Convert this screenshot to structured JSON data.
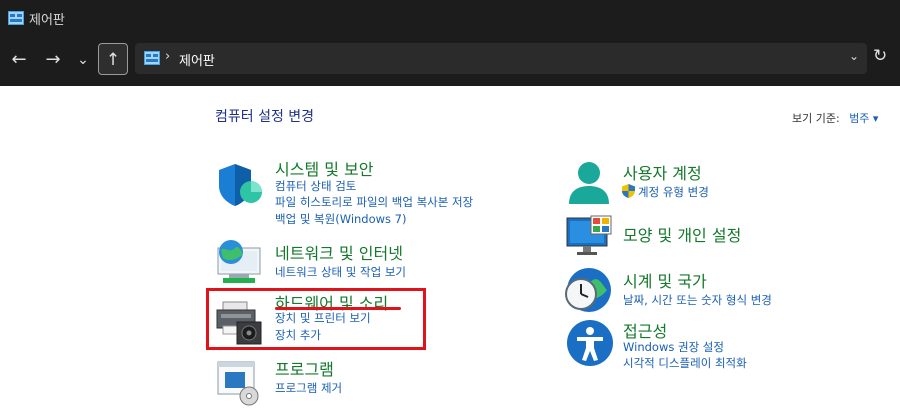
{
  "window": {
    "title": "제어판"
  },
  "nav": {
    "back": "←",
    "forward": "→",
    "recent": "⌄",
    "up": "↑",
    "refresh": "↻",
    "breadcrumb": "제어판",
    "separator": "›",
    "dropdown": "⌄"
  },
  "main": {
    "heading": "컴퓨터 설정 변경",
    "view_by_label": "보기 기준:",
    "view_by_value": "범주 ▾"
  },
  "categories_left": [
    {
      "title": "시스템 및 보안",
      "icon": "shield-icon",
      "links": [
        "컴퓨터 상태 검토",
        "파일 히스토리로 파일의 백업 복사본 저장",
        "백업 및 복원(Windows 7)"
      ]
    },
    {
      "title": "네트워크 및 인터넷",
      "icon": "network-globe-icon",
      "links": [
        "네트워크 상태 및 작업 보기"
      ]
    },
    {
      "title": "하드웨어 및 소리",
      "icon": "printer-speaker-icon",
      "links": [
        "장치 및 프린터 보기",
        "장치 추가"
      ]
    },
    {
      "title": "프로그램",
      "icon": "programs-icon",
      "links": [
        "프로그램 제거"
      ]
    }
  ],
  "categories_right": [
    {
      "title": "사용자 계정",
      "icon": "user-icon",
      "links": [
        "계정 유형 변경"
      ]
    },
    {
      "title": "모양 및 개인 설정",
      "icon": "monitor-appearance-icon",
      "links": []
    },
    {
      "title": "시계 및 국가",
      "icon": "clock-globe-icon",
      "links": [
        "날짜, 시간 또는 숫자 형식 변경"
      ]
    },
    {
      "title": "접근성",
      "icon": "accessibility-icon",
      "links": [
        "Windows 권장 설정",
        "시각적 디스플레이 최적화"
      ]
    }
  ],
  "colors": {
    "title_green": "#14792c",
    "link_blue": "#1a5fb4",
    "highlight_red": "#e0121a"
  }
}
